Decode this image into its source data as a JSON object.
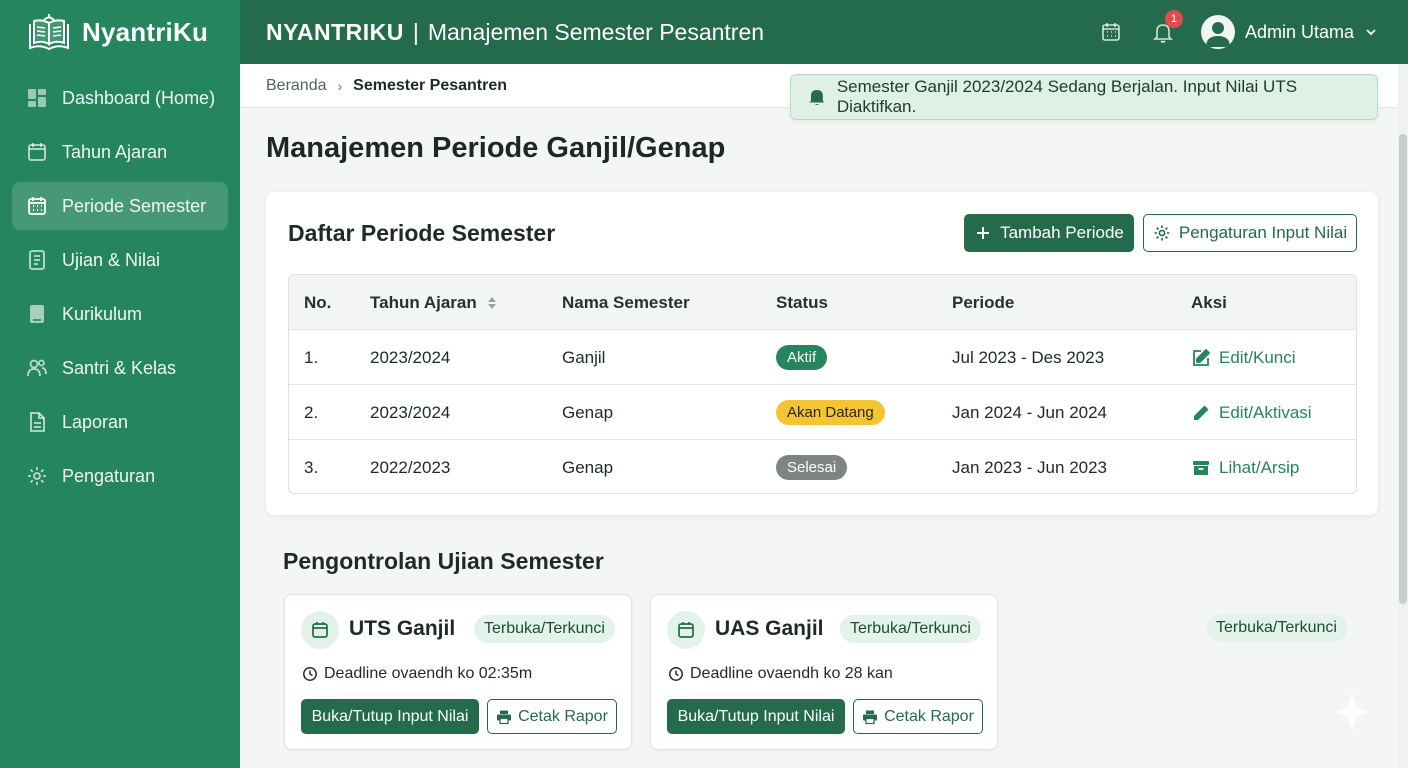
{
  "brand": {
    "name": "NyantriKu"
  },
  "sidebar": {
    "items": [
      {
        "label": "Dashboard (Home)",
        "icon": "dashboard-icon"
      },
      {
        "label": "Tahun Ajaran",
        "icon": "calendar-icon"
      },
      {
        "label": "Periode Semester",
        "icon": "calendar-grid-icon",
        "active": true
      },
      {
        "label": "Ujian & Nilai",
        "icon": "document-icon"
      },
      {
        "label": "Kurikulum",
        "icon": "book-icon"
      },
      {
        "label": "Santri & Kelas",
        "icon": "users-icon"
      },
      {
        "label": "Laporan",
        "icon": "report-icon"
      },
      {
        "label": "Pengaturan",
        "icon": "gear-icon"
      }
    ]
  },
  "header": {
    "title_bold": "NYANTRIKU",
    "title_sep": "|",
    "title_rest": "Manajemen Semester Pesantren",
    "notification_count": "1",
    "user_name": "Admin Utama"
  },
  "breadcrumb": {
    "home": "Beranda",
    "current": "Semester Pesantren"
  },
  "notification": {
    "text": "Semester Ganjil 2023/2024 Sedang Berjalan. Input Nilai UTS Diaktifkan."
  },
  "page": {
    "title": "Manajemen Periode Ganjil/Genap"
  },
  "periods": {
    "title": "Daftar Periode Semester",
    "add_button": "Tambah Periode",
    "settings_button": "Pengaturan Input Nilai",
    "columns": [
      "No.",
      "Tahun Ajaran",
      "Nama Semester",
      "Status",
      "Periode",
      "Aksi"
    ],
    "rows": [
      {
        "no": "1.",
        "year": "2023/2024",
        "semester": "Ganjil",
        "status": "Aktif",
        "period": "Jul 2023 - Des 2023",
        "action": "Edit/Kunci"
      },
      {
        "no": "2.",
        "year": "2023/2024",
        "semester": "Genap",
        "status": "Akan Datang",
        "period": "Jan 2024 - Jun 2024",
        "action": "Edit/Aktivasi"
      },
      {
        "no": "3.",
        "year": "2022/2023",
        "semester": "Genap",
        "status": "Selesai",
        "period": "Jan 2023 - Jun 2023",
        "action": "Lihat/Arsip"
      }
    ]
  },
  "exams": {
    "title": "Pengontrolan Ujian Semester",
    "cards": [
      {
        "name": "UTS Ganjil",
        "tag": "Terbuka/Terkunci",
        "deadline": "Deadline ovaendh ko 02:35m",
        "toggle_button": "Buka/Tutup Input Nilai",
        "print_button": "Cetak Rapor"
      },
      {
        "name": "UAS Ganjil",
        "tag": "Terbuka/Terkunci",
        "deadline": "Deadline ovaendh ko 28 kan",
        "toggle_button": "Buka/Tutup Input Nilai",
        "print_button": "Cetak Rapor"
      }
    ],
    "extra_tag": "Terbuka/Terkunci"
  },
  "colors": {
    "sidebar": "#24855f",
    "header": "#246b4d",
    "accent": "#24855f",
    "status_active": "#24855f",
    "status_upcoming": "#f3c533",
    "status_done": "#7d8482"
  }
}
